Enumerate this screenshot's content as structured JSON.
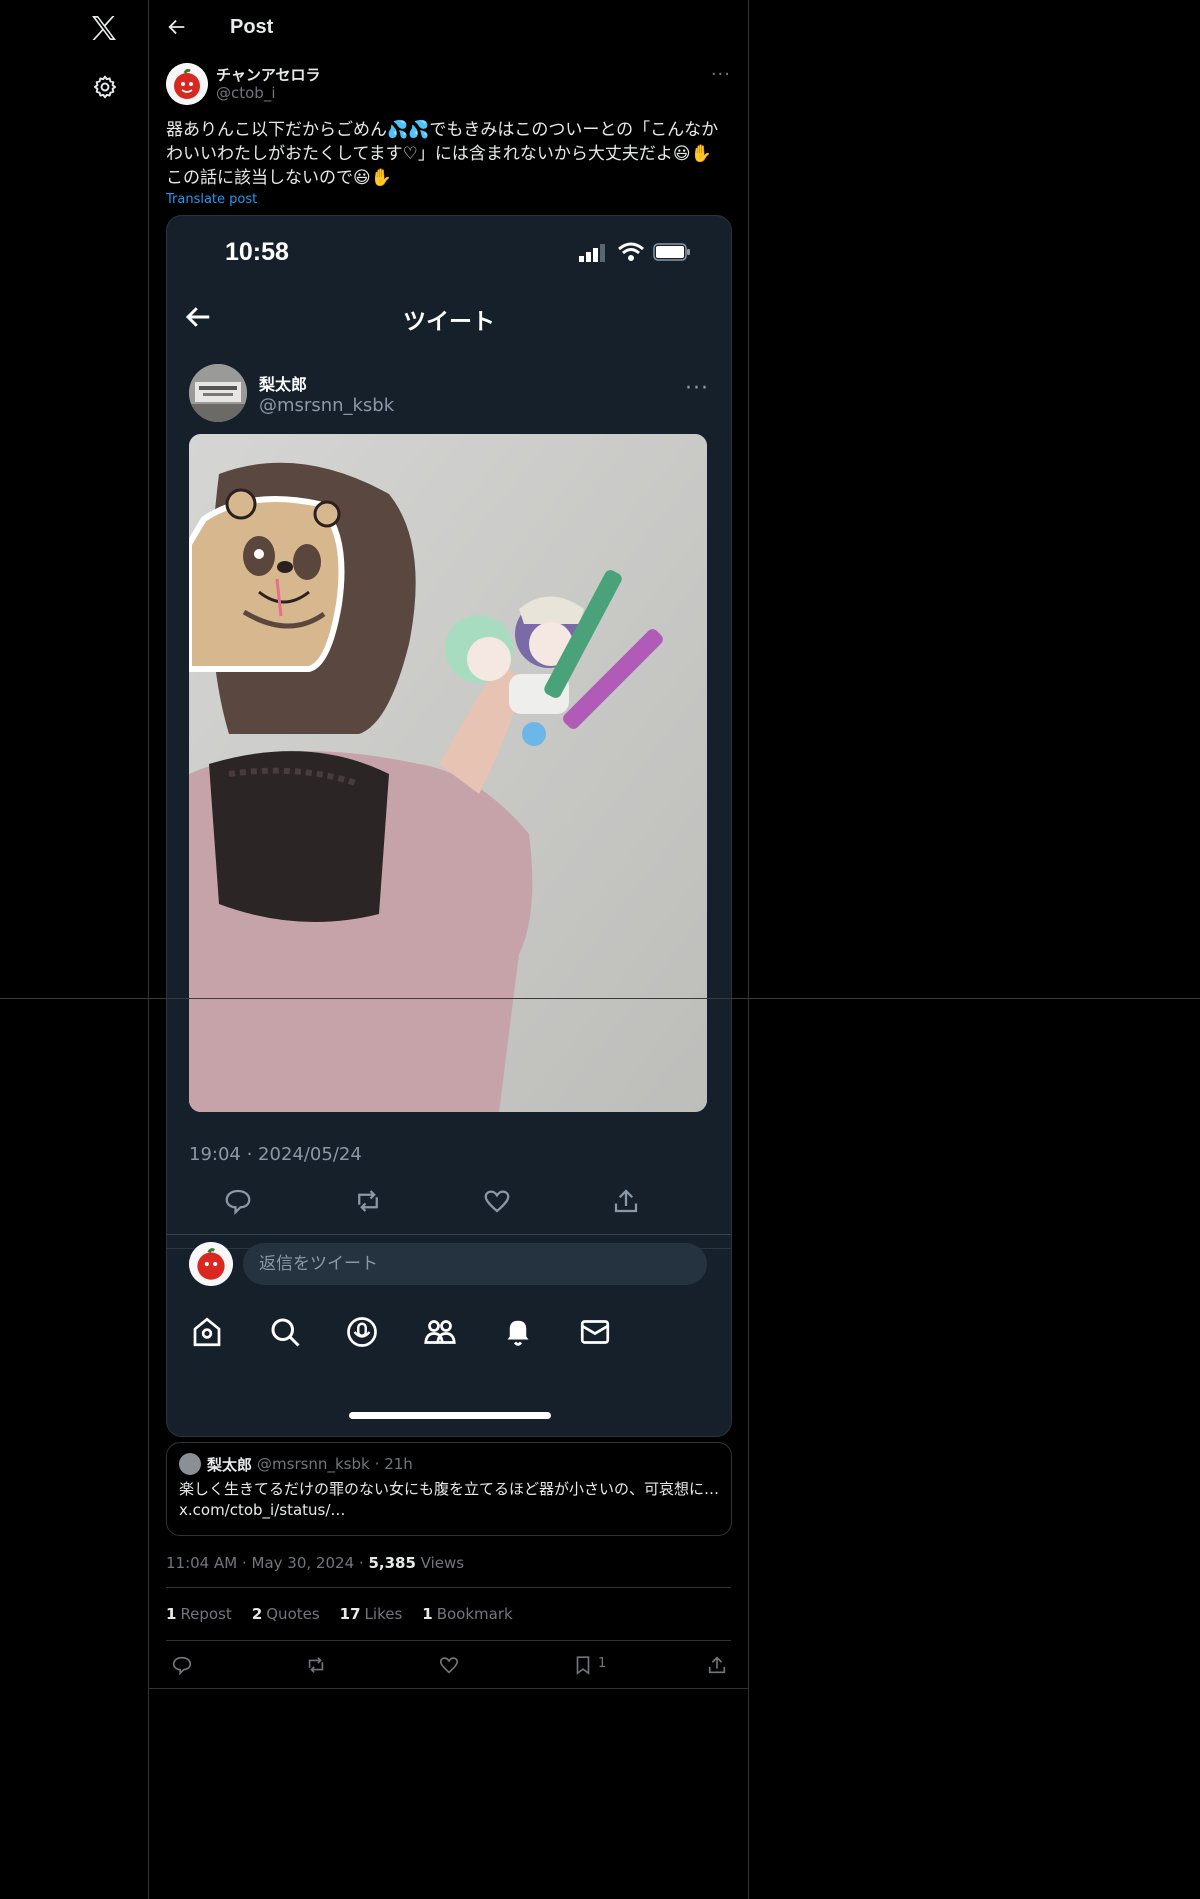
{
  "header": {
    "title": "Post"
  },
  "post": {
    "display_name": "チャンアセロラ",
    "handle": "@ctob_i",
    "more": "···",
    "text": "器ありんこ以下だからごめん💦💦でもきみはこのついーとの「こんなかわいいわたしがおたくしてます♡」には含まれないから大丈夫だよ😃✋この話に該当しないので😃✋",
    "translate": "Translate post"
  },
  "screenshot": {
    "time": "10:58",
    "title": "ツイート",
    "author_name": "梨太郎",
    "author_handle": "@msrsnn_ksbk",
    "more": "···",
    "date": "19:04 · 2024/05/24",
    "reply_placeholder": "返信をツイート"
  },
  "quote": {
    "name": "梨太郎",
    "handle": "@msrsnn_ksbk",
    "age": "· 21h",
    "line1": "楽しく生きてるだけの罪のない女にも腹を立てるほど器が小さいの、可哀想に…",
    "line2": "x.com/ctob_i/status/…"
  },
  "meta": {
    "time": "11:04 AM",
    "date": "May 30, 2024",
    "views_count": "5,385",
    "views_label": "Views"
  },
  "stats": [
    {
      "count": "1",
      "label": "Repost"
    },
    {
      "count": "2",
      "label": "Quotes"
    },
    {
      "count": "17",
      "label": "Likes"
    },
    {
      "count": "1",
      "label": "Bookmark"
    }
  ],
  "actions": {
    "bookmark_count": "1"
  },
  "colors": {
    "accent": "#1d9bf0",
    "dim_bg": "#15202b",
    "border": "#2f3336"
  }
}
